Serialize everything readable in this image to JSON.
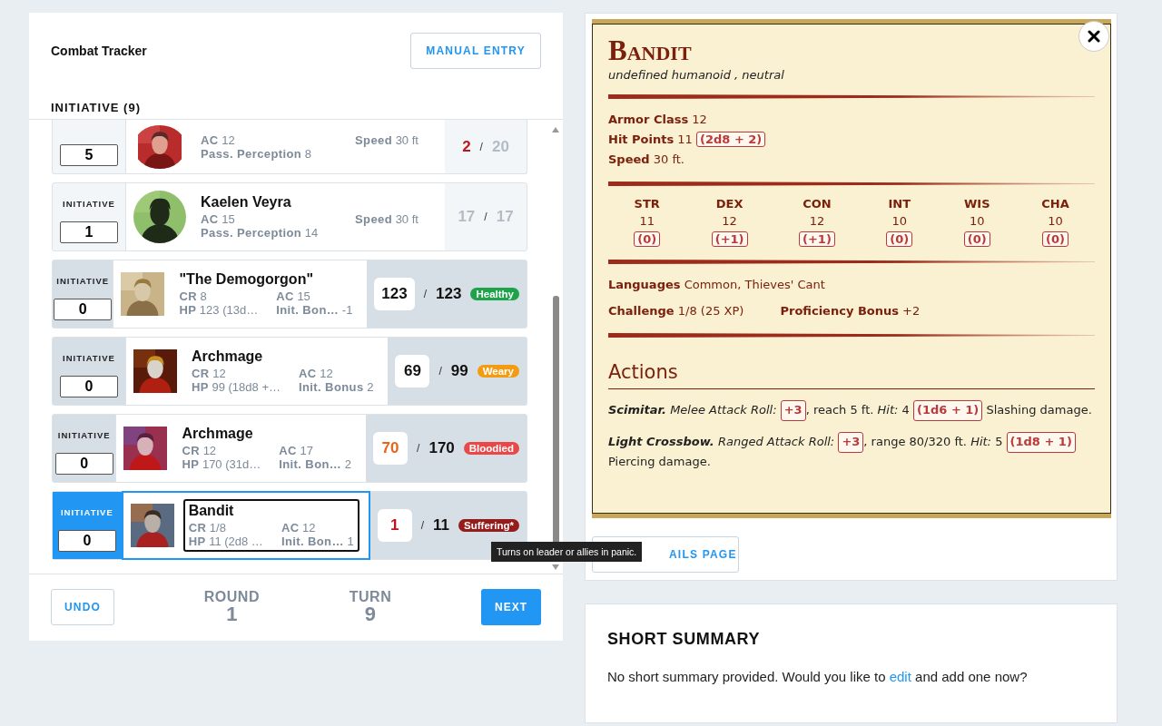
{
  "tracker": {
    "title": "Combat Tracker",
    "manual_button": "MANUAL ENTRY",
    "list_heading": "INITIATIVE (9)",
    "rows": [
      {
        "kind": "player",
        "selected": false,
        "focused": false,
        "initiative": "5",
        "stats": [
          {
            "label": "AC",
            "value": "12"
          },
          {
            "label": "Speed",
            "value": "30 ft"
          },
          {
            "label": "Pass. Perception",
            "value": "8"
          }
        ],
        "hp": {
          "text": "2",
          "color": "#c0141c"
        },
        "separator": "/",
        "hp_max": "20"
      },
      {
        "kind": "player",
        "selected": false,
        "focused": false,
        "initiative_label": "INITIATIVE",
        "initiative": "1",
        "name": "Kaelen Veyra",
        "stats": [
          {
            "label": "AC",
            "value": "15"
          },
          {
            "label": "Speed",
            "value": "30 ft"
          },
          {
            "label": "Pass. Perception",
            "value": "14"
          }
        ],
        "hp": {
          "text": "17",
          "color": "#b3bcc6"
        },
        "separator": "/",
        "hp_max": "17"
      },
      {
        "kind": "monster",
        "selected": false,
        "focused": false,
        "initiative_label": "INITIATIVE",
        "initiative": "0",
        "name": "\"The Demogorgon\"",
        "stats": [
          {
            "label": "CR",
            "value": "8"
          },
          {
            "label": "AC",
            "value": "15"
          },
          {
            "label": "HP",
            "value": "123 (13d…"
          },
          {
            "label": "Init. Bon…",
            "value": "-1"
          }
        ],
        "hp": {
          "text": "123",
          "color": "#111111"
        },
        "separator": "/",
        "hp_max": "123",
        "status": {
          "text": "Healthy",
          "color": "#1ea34a"
        }
      },
      {
        "kind": "monster",
        "selected": false,
        "focused": false,
        "initiative_label": "INITIATIVE",
        "initiative": "0",
        "name": "Archmage",
        "stats": [
          {
            "label": "CR",
            "value": "12"
          },
          {
            "label": "AC",
            "value": "12"
          },
          {
            "label": "HP",
            "value": "99 (18d8 +…"
          },
          {
            "label": "Init. Bonus",
            "value": "2"
          }
        ],
        "hp": {
          "text": "69",
          "color": "#111111"
        },
        "separator": "/",
        "hp_max": "99",
        "status": {
          "text": "Weary",
          "color": "#f39c12"
        }
      },
      {
        "kind": "monster",
        "selected": false,
        "focused": false,
        "initiative_label": "INITIATIVE",
        "initiative": "0",
        "name": "Archmage",
        "stats": [
          {
            "label": "CR",
            "value": "12"
          },
          {
            "label": "AC",
            "value": "17"
          },
          {
            "label": "HP",
            "value": "170 (31d…"
          },
          {
            "label": "Init. Bon…",
            "value": "2"
          }
        ],
        "hp": {
          "text": "70",
          "color": "#e8641a"
        },
        "separator": "/",
        "hp_max": "170",
        "status": {
          "text": "Bloodied",
          "color": "#e84848"
        }
      },
      {
        "kind": "monster",
        "selected": true,
        "focused": true,
        "initiative_label": "INITIATIVE",
        "initiative": "0",
        "name": "Bandit",
        "stats": [
          {
            "label": "CR",
            "value": "1/8"
          },
          {
            "label": "AC",
            "value": "12"
          },
          {
            "label": "HP",
            "value": "11 (2d8 …"
          },
          {
            "label": "Init. Bon…",
            "value": "1"
          }
        ],
        "hp": {
          "text": "1",
          "color": "#c0141c"
        },
        "separator": "/",
        "hp_max": "11",
        "status": {
          "text": "Suffering*",
          "color": "#961c1c"
        }
      }
    ],
    "tooltip": "Turns on leader or allies in panic.",
    "undo": "UNDO",
    "round": {
      "label": "ROUND",
      "value": "1"
    },
    "turn": {
      "label": "TURN",
      "value": "9"
    },
    "next": "NEXT"
  },
  "statblock": {
    "name": "Bandit",
    "subtitle": "undefined humanoid , neutral",
    "properties": [
      {
        "label": "Armor Class",
        "value": "12"
      },
      {
        "label": "Hit Points",
        "value": "11",
        "dice": "(2d8 + 2)"
      },
      {
        "label": "Speed",
        "value": "30 ft."
      }
    ],
    "abilities": [
      {
        "name": "STR",
        "score": "11",
        "mod": "(0)"
      },
      {
        "name": "DEX",
        "score": "12",
        "mod": "(+1)"
      },
      {
        "name": "CON",
        "score": "12",
        "mod": "(+1)"
      },
      {
        "name": "INT",
        "score": "10",
        "mod": "(0)"
      },
      {
        "name": "WIS",
        "score": "10",
        "mod": "(0)"
      },
      {
        "name": "CHA",
        "score": "10",
        "mod": "(0)"
      }
    ],
    "languages": {
      "label": "Languages",
      "value": "Common, Thieves' Cant"
    },
    "challenge": [
      {
        "label": "Challenge",
        "value": "1/8 (25 XP)"
      },
      {
        "label": "Proficiency Bonus",
        "value": "+2"
      }
    ],
    "actions_heading": "Actions",
    "actions": [
      {
        "segments": [
          {
            "kind": "name",
            "text": "Scimitar."
          },
          {
            "kind": "italic",
            "text": "Melee Attack Roll:"
          },
          {
            "kind": "dice",
            "text": "+3"
          },
          {
            "kind": "cont",
            "text": ", reach 5 ft."
          },
          {
            "kind": "italic",
            "text": "Hit:"
          },
          {
            "kind": "text",
            "text": "4"
          },
          {
            "kind": "dice",
            "text": "(1d6 + 1)"
          },
          {
            "kind": "text",
            "text": "Slashing damage."
          }
        ]
      },
      {
        "segments": [
          {
            "kind": "name",
            "text": "Light Crossbow."
          },
          {
            "kind": "italic",
            "text": "Ranged Attack Roll:"
          },
          {
            "kind": "dice",
            "text": "+3"
          },
          {
            "kind": "cont",
            "text": ", range 80/320 ft."
          },
          {
            "kind": "italic",
            "text": "Hit:"
          },
          {
            "kind": "text",
            "text": "5"
          },
          {
            "kind": "dice",
            "text": "(1d8 + 1)"
          },
          {
            "kind": "text",
            "text": "Piercing damage."
          }
        ]
      }
    ]
  },
  "details_button": "AILS PAGE",
  "summary": {
    "title": "SHORT SUMMARY",
    "text_before": "No short summary provided. Would you like to",
    "link": "edit",
    "text_after": "and add one now?"
  }
}
